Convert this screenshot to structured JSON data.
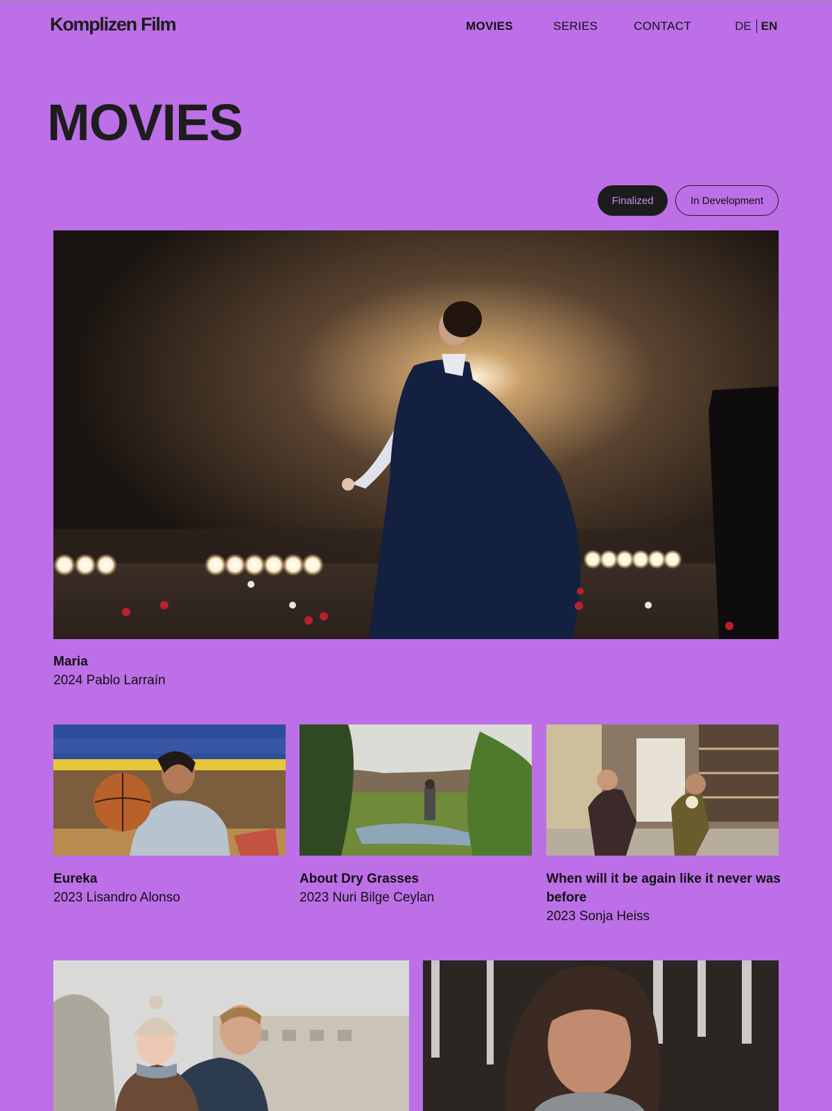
{
  "header": {
    "logo": "Komplizen Film",
    "nav": [
      {
        "label": "MOVIES",
        "active": true
      },
      {
        "label": "SERIES",
        "active": false
      },
      {
        "label": "CONTACT",
        "active": false
      }
    ],
    "lang": {
      "de": "DE",
      "en": "EN",
      "active": "EN"
    }
  },
  "page": {
    "title": "MOVIES"
  },
  "filters": [
    {
      "label": "Finalized",
      "active": true
    },
    {
      "label": "In Development",
      "active": false
    }
  ],
  "featured": {
    "title": "Maria",
    "meta": "2024 Pablo Larraín"
  },
  "grid": [
    {
      "title": "Eureka",
      "meta": "2023 Lisandro Alonso"
    },
    {
      "title": "About Dry Grasses",
      "meta": "2023 Nuri Bilge Ceylan"
    },
    {
      "title_line1": "When will it be again like it never was",
      "title_line2": "before",
      "meta": "2023 Sonja Heiss"
    }
  ],
  "colors": {
    "background": "#bd6fe8",
    "text": "#111111",
    "pill_active_bg": "#1c1c1c",
    "pill_active_text": "#c98cf0"
  }
}
